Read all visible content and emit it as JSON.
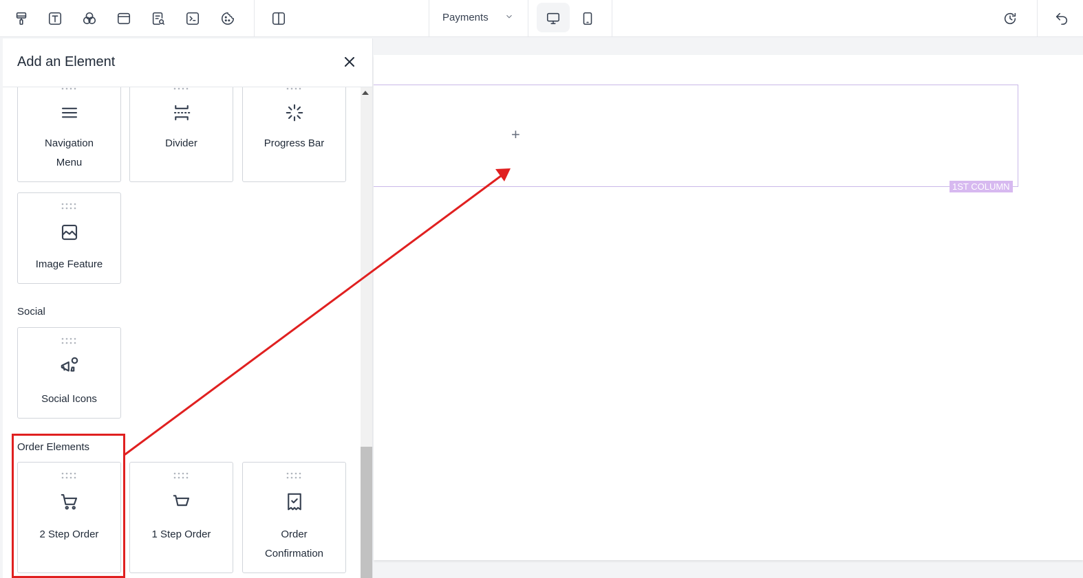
{
  "toolbar": {
    "icons": [
      "paint-roller-icon",
      "text-icon",
      "color-circles-icon",
      "card-icon",
      "page-search-icon",
      "terminal-icon",
      "cookie-icon",
      "split-view-icon"
    ],
    "dropdown_label": "Payments",
    "devices": [
      "desktop-icon",
      "mobile-icon"
    ],
    "right_icons": [
      "history-icon",
      "undo-icon"
    ]
  },
  "panel": {
    "title": "Add an Element",
    "sections": {
      "social": "Social",
      "order": "Order Elements"
    },
    "cards": {
      "nav_line1": "Navigation",
      "nav_line2": "Menu",
      "divider": "Divider",
      "progress": "Progress Bar",
      "image_feature": "Image Feature",
      "social_icons": "Social Icons",
      "two_step": "2 Step Order",
      "one_step": "1 Step Order",
      "conf_line1": "Order",
      "conf_line2": "Confirmation"
    }
  },
  "canvas": {
    "add_symbol": "+",
    "column_label": "1ST COLUMN"
  },
  "colors": {
    "annotation": "#e02020",
    "column_border": "#c9b8e8",
    "column_label_bg": "#d7b9f0"
  }
}
